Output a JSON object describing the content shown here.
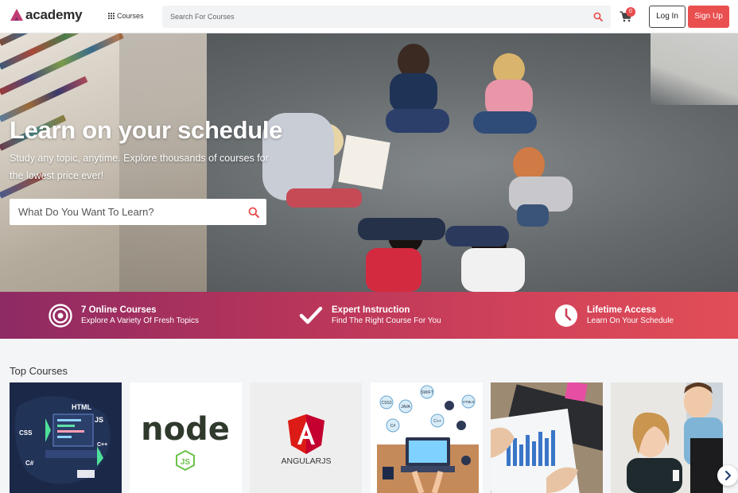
{
  "header": {
    "logo_text": "academy",
    "courses_label": "Courses",
    "search_placeholder": "Search For Courses",
    "cart_count": "0",
    "login_label": "Log In",
    "signup_label": "Sign Up"
  },
  "hero": {
    "title": "Learn on your schedule",
    "subtitle": "Study any topic, anytime. Explore thousands of courses for the lowest price ever!",
    "search_placeholder": "What Do You Want To Learn?"
  },
  "features": [
    {
      "title": "7 Online Courses",
      "subtitle": "Explore A Variety Of Fresh Topics",
      "icon": "target-icon"
    },
    {
      "title": "Expert Instruction",
      "subtitle": "Find The Right Course For You",
      "icon": "check-icon"
    },
    {
      "title": "Lifetime Access",
      "subtitle": "Learn On Your Schedule",
      "icon": "clock-icon"
    }
  ],
  "top_courses": {
    "title": "Top Courses",
    "cards": [
      {
        "image_text": [
          "HTML",
          "CSS",
          "JS",
          "C++",
          "C#"
        ]
      },
      {
        "image_text": [
          "node",
          "JS"
        ]
      },
      {
        "image_text": [
          "ANGULARJS"
        ]
      },
      {
        "image_text": [
          "CSS3",
          "JAVA",
          "SWIFT",
          "HTML5",
          "C#",
          "C++"
        ]
      },
      {
        "image_text": []
      },
      {
        "image_text": []
      }
    ]
  },
  "colors": {
    "accent": "#ea4f4f",
    "logo": "#c23a73",
    "band_start": "#8e2a64",
    "band_end": "#e24e57"
  }
}
